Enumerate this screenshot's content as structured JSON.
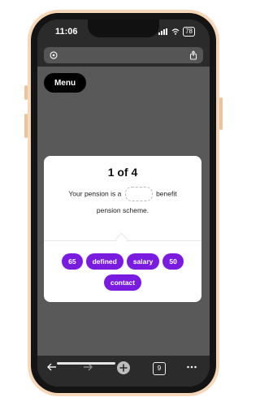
{
  "status": {
    "time": "11:06",
    "battery": "78"
  },
  "page": {
    "menu_label": "Menu"
  },
  "quiz": {
    "progress": "1 of 4",
    "sentence_part1": "Your pension is a",
    "sentence_part2": "benefit",
    "sentence_part3": "pension scheme.",
    "options": [
      "65",
      "defined",
      "salary",
      "50",
      "contact"
    ]
  },
  "browser": {
    "tab_count": "9"
  },
  "colors": {
    "accent": "#7a1be0",
    "overlay_bg": "#595959",
    "button_dark": "#000000"
  },
  "icons": {
    "address_left": "tracking-icon",
    "address_right": "share-icon",
    "back": "back-arrow-icon",
    "forward": "forward-arrow-icon",
    "new_tab": "plus-icon",
    "more": "more-icon"
  }
}
